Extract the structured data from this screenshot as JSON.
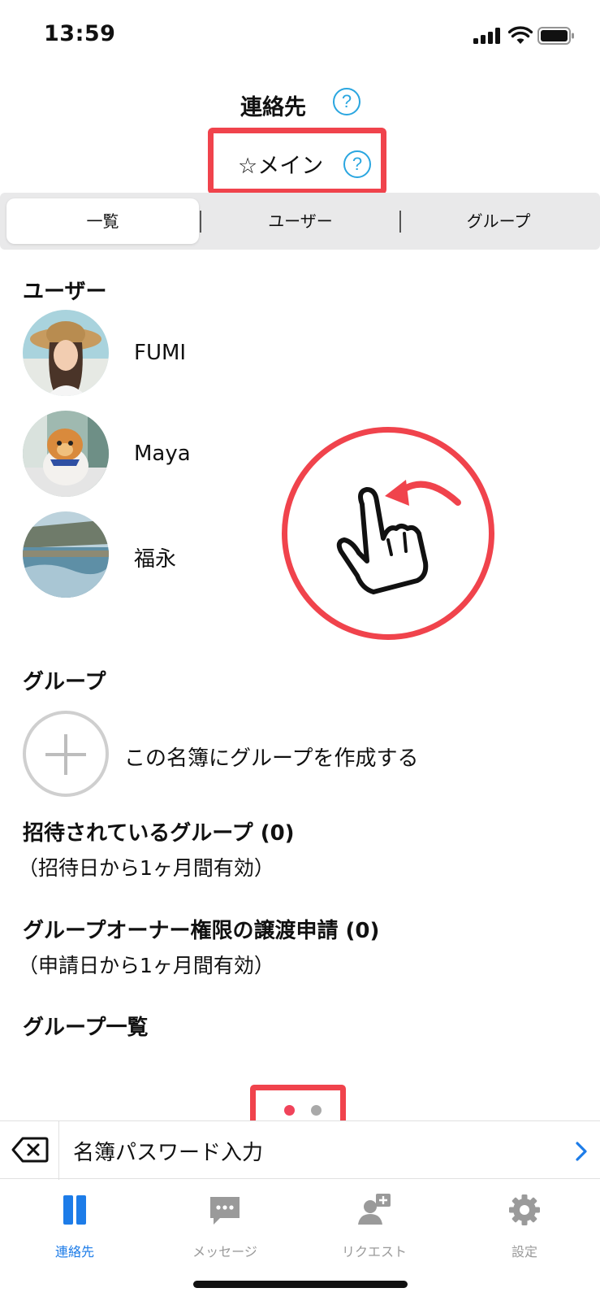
{
  "status_bar": {
    "time": "13:59"
  },
  "header": {
    "title": "連絡先",
    "help_glyph": "?",
    "main_label": "☆メイン"
  },
  "segments": [
    "一覧",
    "ユーザー",
    "グループ"
  ],
  "users_section": {
    "title": "ユーザー",
    "users": [
      {
        "name": "FUMI"
      },
      {
        "name": "Maya"
      },
      {
        "name": "福永"
      }
    ]
  },
  "groups_section": {
    "title": "グループ",
    "create_label": "この名簿にグループを作成する",
    "invited_title": "招待されているグループ (0)",
    "invited_note": "（招待日から1ヶ月間有効）",
    "transfer_title": "グループオーナー権限の譲渡申請 (0)",
    "transfer_note": "（申請日から1ヶ月間有効）",
    "list_title": "グループ一覧"
  },
  "pager": {
    "pages": 2,
    "current": 1
  },
  "password_bar": {
    "label": "名簿パスワード入力",
    "delete_icon": "delete-key-icon",
    "chevron_icon": "chevron-right-icon"
  },
  "tab_bar": {
    "tabs": [
      {
        "label": "連絡先",
        "icon": "contacts-icon",
        "active": true
      },
      {
        "label": "メッセージ",
        "icon": "message-icon",
        "active": false
      },
      {
        "label": "リクエスト",
        "icon": "add-user-request-icon",
        "active": false
      },
      {
        "label": "設定",
        "icon": "gear-icon",
        "active": false
      }
    ]
  },
  "colors": {
    "accent": "#1d7ce8",
    "highlight": "#f0434c",
    "help": "#2aa6e0",
    "inactive": "#9a9a9a"
  }
}
